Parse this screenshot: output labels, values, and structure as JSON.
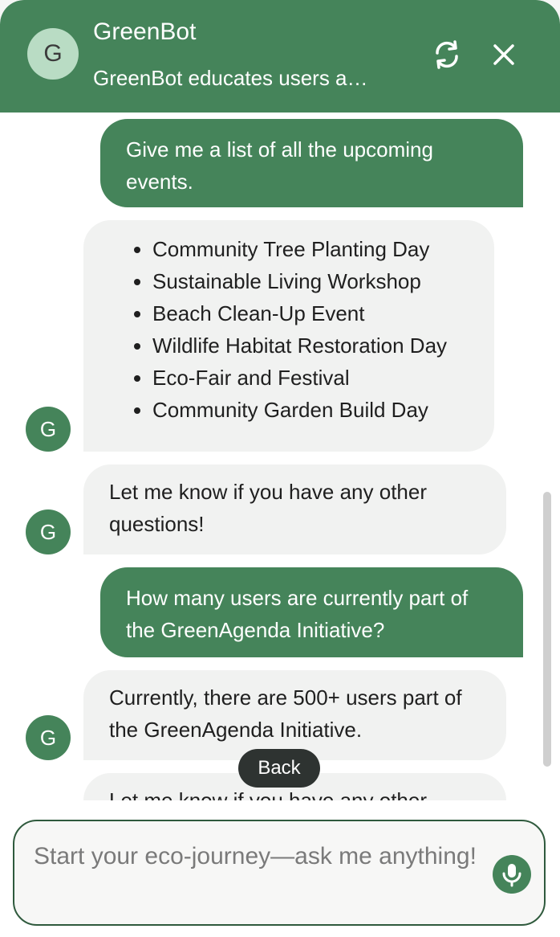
{
  "header": {
    "avatar_letter": "G",
    "title": "GreenBot",
    "subtitle": "GreenBot educates users a…",
    "refresh_icon": "refresh-icon",
    "close_icon": "close-icon"
  },
  "colors": {
    "brand": "#45845a",
    "bot_bubble": "#f1f2f1",
    "back_button": "#2e3331"
  },
  "messages": [
    {
      "role": "user",
      "text": "Give me a list of all the upcoming events."
    },
    {
      "role": "bot",
      "avatar": "G",
      "list": [
        "Community Tree Planting Day",
        "Sustainable Living Workshop",
        "Beach Clean-Up Event",
        "Wildlife Habitat Restoration Day",
        "Eco-Fair and Festival",
        "Community Garden Build Day"
      ]
    },
    {
      "role": "bot",
      "avatar": "G",
      "text": "Let me know if you have any other questions!"
    },
    {
      "role": "user",
      "text": "How many users are currently part of the GreenAgenda Initiative?"
    },
    {
      "role": "bot",
      "avatar": "G",
      "text": "Currently, there are 500+ users part of the GreenAgenda Initiative."
    },
    {
      "role": "bot",
      "avatar": "G",
      "text": "Let me know if you have any other"
    }
  ],
  "back_button": {
    "label": "Back"
  },
  "input": {
    "value": "",
    "placeholder": "Start your eco-journey—ask me anything!",
    "mic_icon": "microphone-icon"
  }
}
